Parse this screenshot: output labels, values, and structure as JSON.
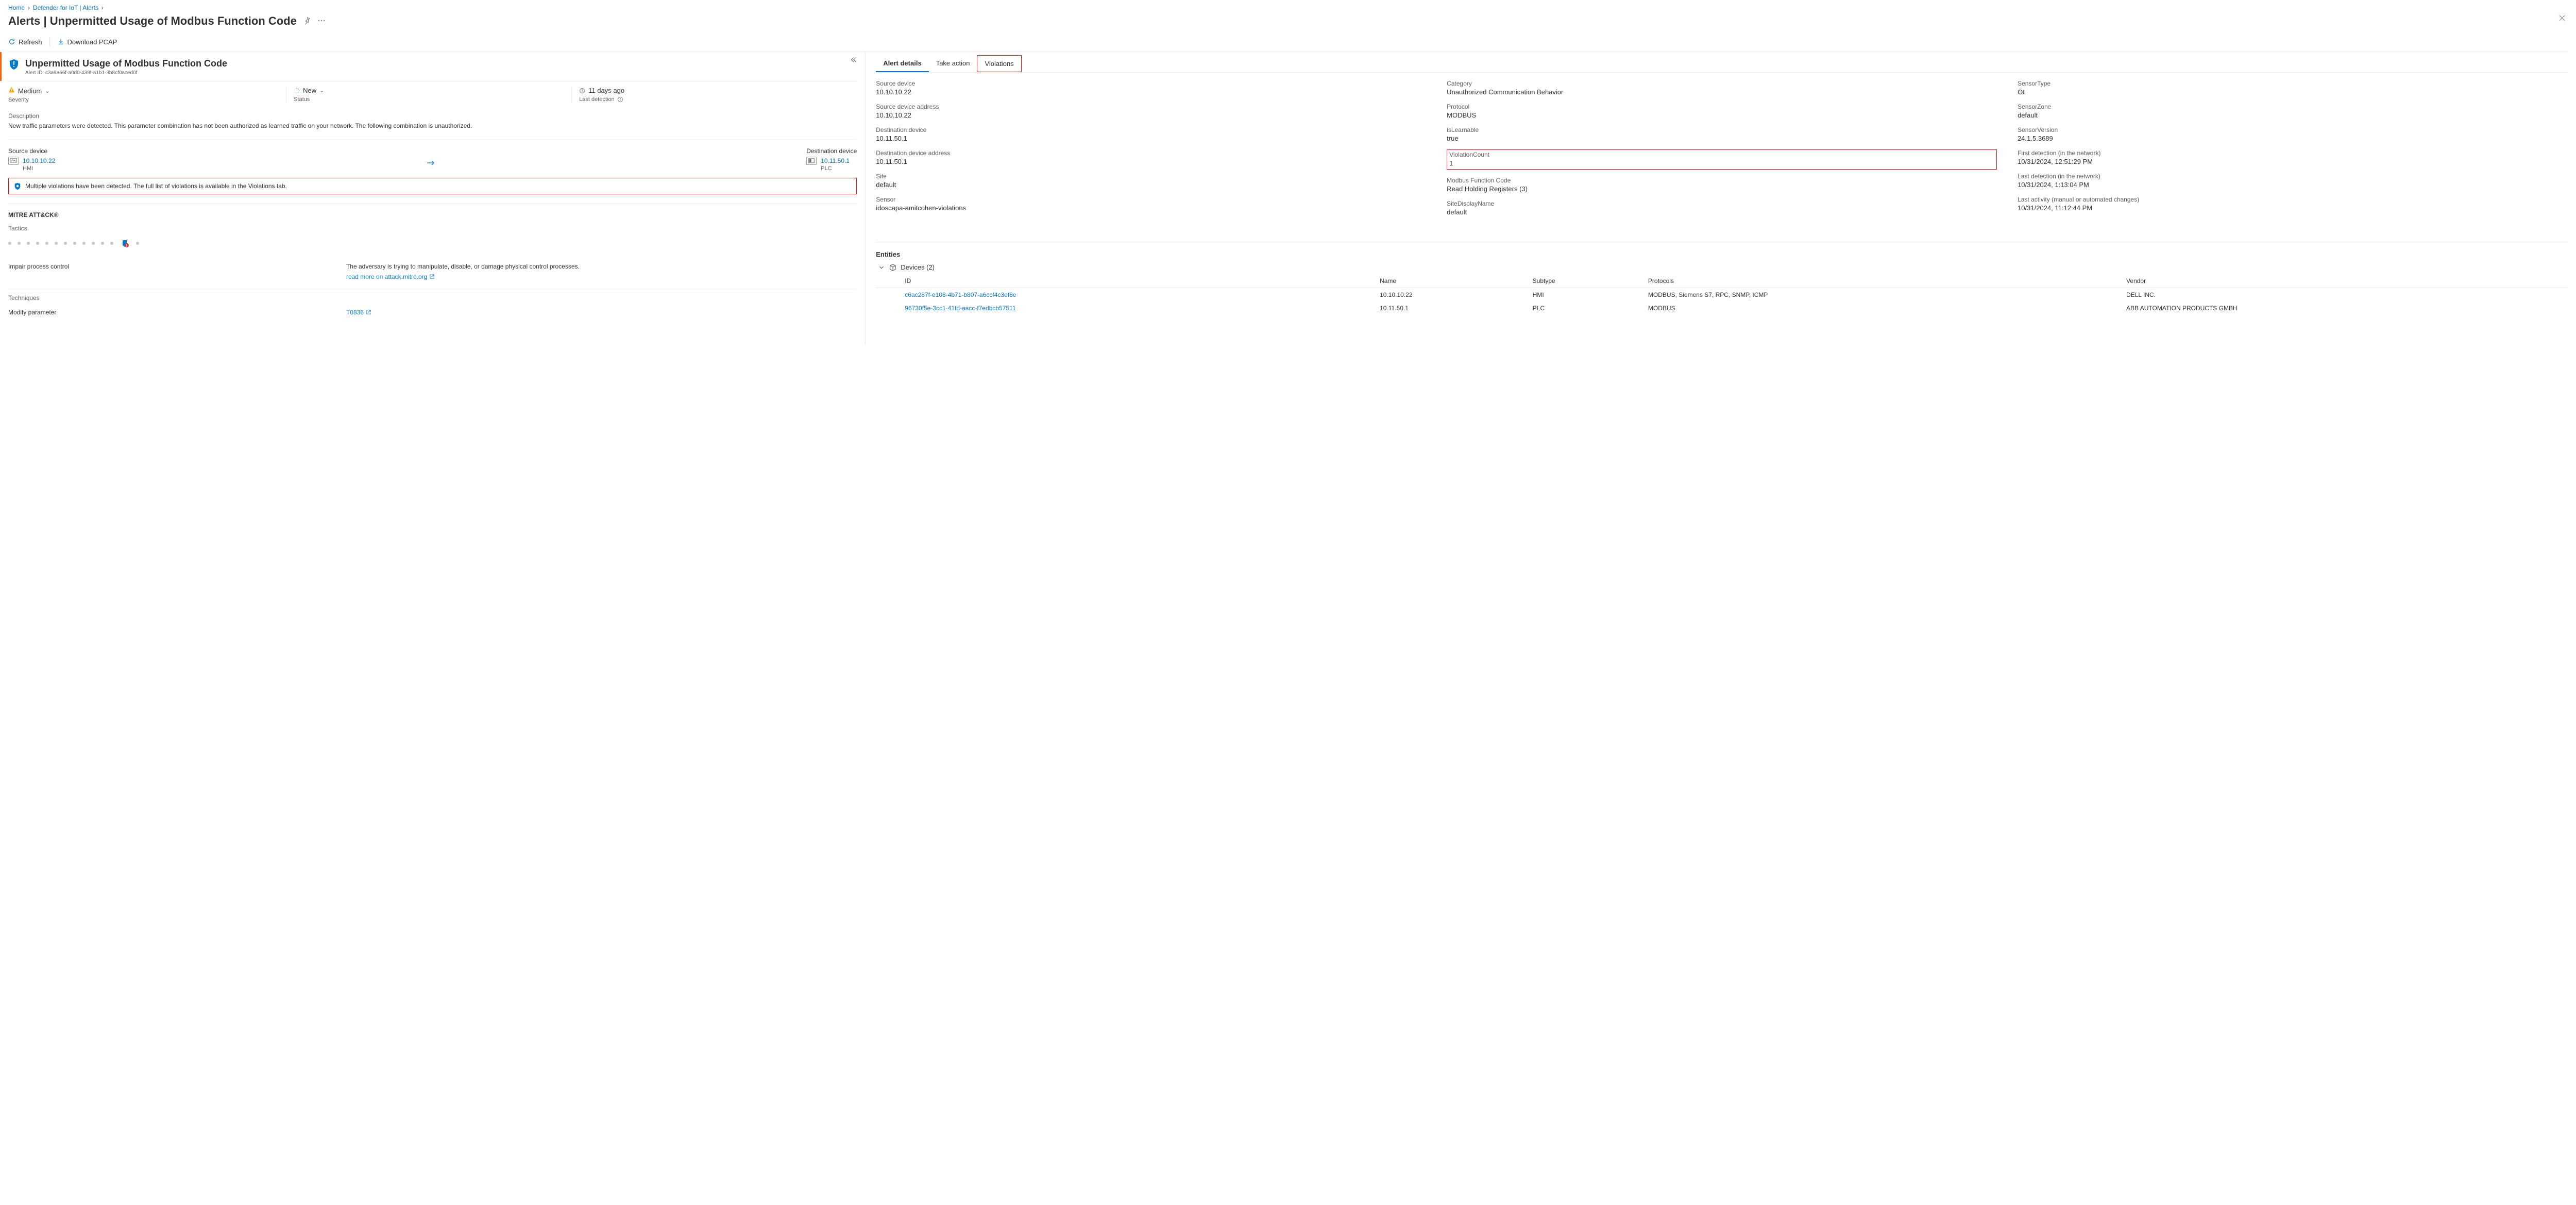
{
  "breadcrumb": [
    {
      "label": "Home"
    },
    {
      "label": "Defender for IoT | Alerts"
    }
  ],
  "page_title_prefix": "Alerts | ",
  "page_title": "Unpermitted Usage of Modbus Function Code",
  "commands": {
    "refresh": "Refresh",
    "download_pcap": "Download PCAP"
  },
  "alert": {
    "title": "Unpermitted Usage of Modbus Function Code",
    "id_label": "Alert ID: ",
    "id": "c3a9a66f-a0d0-439f-a1b1-3b8cf0aced0f",
    "severity_value": "Medium",
    "severity_label": "Severity",
    "status_value": "New",
    "status_label": "Status",
    "last_detection_value": "11 days ago",
    "last_detection_label": "Last detection",
    "description_label": "Description",
    "description_text": "New traffic parameters were detected. This parameter combination has not been authorized as learned traffic on your network. The following combination is unauthorized.",
    "src_label": "Source device",
    "src_ip": "10.10.10.22",
    "src_type": "HMI",
    "dst_label": "Destination device",
    "dst_ip": "10.11.50.1",
    "dst_type": "PLC",
    "banner_text": "Multiple violations have been detected. The full list of violations is available in the Violations tab."
  },
  "mitre": {
    "title": "MITRE ATT&CK®",
    "tactics_label": "Tactics",
    "tactic_name": "Impair process control",
    "tactic_desc": "The adversary is trying to manipulate, disable, or damage physical control processes.",
    "read_more": "read more on attack.mitre.org",
    "techniques_label": "Techniques",
    "technique_name": "Modify parameter",
    "technique_id": "T0836"
  },
  "tabs": {
    "alert_details": "Alert details",
    "take_action": "Take action",
    "violations": "Violations"
  },
  "properties": {
    "col1": [
      {
        "label": "Source device",
        "value": "10.10.10.22"
      },
      {
        "label": "Source device address",
        "value": "10.10.10.22"
      },
      {
        "label": "Destination device",
        "value": "10.11.50.1"
      },
      {
        "label": "Destination device address",
        "value": "10.11.50.1"
      },
      {
        "label": "Site",
        "value": "default"
      },
      {
        "label": "Sensor",
        "value": "idoscapa-amitcohen-violations"
      }
    ],
    "col2": [
      {
        "label": "Category",
        "value": "Unauthorized Communication Behavior"
      },
      {
        "label": "Protocol",
        "value": "MODBUS"
      },
      {
        "label": "isLearnable",
        "value": "true"
      },
      {
        "label": "ViolationCount",
        "value": "1",
        "highlight": true
      },
      {
        "label": "Modbus Function Code",
        "value": "Read Holding Registers (3)"
      },
      {
        "label": "SiteDisplayName",
        "value": "default"
      }
    ],
    "col3": [
      {
        "label": "SensorType",
        "value": "Ot"
      },
      {
        "label": "SensorZone",
        "value": "default"
      },
      {
        "label": "SensorVersion",
        "value": "24.1.5.3689"
      },
      {
        "label": "First detection (in the network)",
        "value": "10/31/2024, 12:51:29 PM"
      },
      {
        "label": "Last detection (in the network)",
        "value": "10/31/2024, 1:13:04 PM"
      },
      {
        "label": "Last activity (manual or automated changes)",
        "value": "10/31/2024, 11:12:44 PM"
      }
    ]
  },
  "entities": {
    "section_title": "Entities",
    "devices_label": "Devices (2)",
    "columns": [
      "ID",
      "Name",
      "Subtype",
      "Protocols",
      "Vendor"
    ],
    "rows": [
      {
        "id": "c6ac287f-e108-4b71-b807-a6ccf4c3ef8e",
        "name": "10.10.10.22",
        "subtype": "HMI",
        "protocols": "MODBUS, Siemens S7, RPC, SNMP, ICMP",
        "vendor": "DELL INC."
      },
      {
        "id": "96730f5e-3cc1-41fd-aacc-f7edbcb57511",
        "name": "10.11.50.1",
        "subtype": "PLC",
        "protocols": "MODBUS",
        "vendor": "ABB AUTOMATION PRODUCTS GMBH"
      }
    ]
  }
}
